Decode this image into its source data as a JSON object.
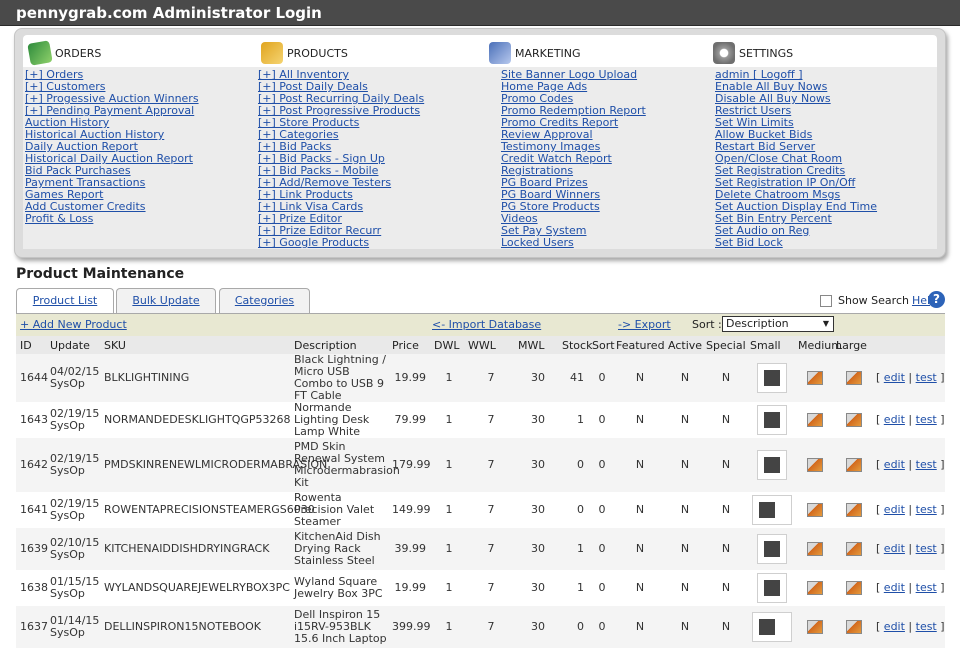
{
  "window": {
    "title": "pennygrab.com Administrator Login"
  },
  "menu": {
    "orders": {
      "heading": "ORDERS",
      "icon": "money-icon",
      "items": [
        "[+] Orders",
        "[+] Customers",
        "[+] Progessive Auction Winners",
        "[+] Pending Payment Approval",
        "Auction History",
        "Historical Auction History",
        "Daily Auction Report",
        "Historical Daily Auction Report",
        "Bid Pack Purchases",
        "Payment Transactions",
        "Games Report",
        "Add Customer Credits",
        "Profit & Loss"
      ]
    },
    "products": {
      "heading": "PRODUCTS",
      "icon": "box-icon",
      "items": [
        "[+] All Inventory",
        "[+] Post Daily Deals",
        "[+] Post Recurring Daily Deals",
        "[+] Post Progressive Products",
        "[+] Store Products",
        "[+] Categories",
        "[+] Bid Packs",
        "[+] Bid Packs - Sign Up",
        "[+] Bid Packs - Mobile",
        "[+] Add/Remove Testers",
        "[+] Link Products",
        "[+] Link Visa Cards",
        "[+] Prize Editor",
        "[+] Prize Editor Recurr",
        "[+] Google Products"
      ]
    },
    "marketing": {
      "heading": "MARKETING",
      "icon": "chart-icon",
      "items": [
        "Site Banner Logo Upload",
        "Home Page Ads",
        "Promo Codes",
        "Promo Redemption Report",
        "Promo Credits Report",
        "Review Approval",
        "Testimony Images",
        "Credit Watch Report",
        "Registrations",
        "PG Board Prizes",
        "PG Board Winners",
        "PG Store Products",
        "Videos",
        "Set Pay System",
        "Locked Users"
      ]
    },
    "settings": {
      "heading": "SETTINGS",
      "icon": "gear-icon",
      "items": [
        "admin [ Logoff ]",
        "Enable All Buy Nows",
        "Disable All Buy Nows",
        "Restrict Users",
        "Set Win Limits",
        "Allow Bucket Bids",
        "Restart Bid Server",
        "Open/Close Chat Room",
        "Set Registration Credits",
        "Set Registration IP On/Off",
        "Delete Chatroom Msgs",
        "Set Auction Display End Time",
        "Set Bin Entry Percent",
        "Set Audio on Reg",
        "Set Bid Lock"
      ]
    }
  },
  "main": {
    "title": "Product Maintenance",
    "tabs": [
      "Product List",
      "Bulk Update",
      "Categories"
    ],
    "show_search_label": "Show Search",
    "help_label": "Help",
    "add_new": "+ Add New Product",
    "import_db": "<- Import Database",
    "export": "-> Export",
    "sort_label": "Sort :",
    "sort_value": "Description"
  },
  "table": {
    "columns": [
      "ID",
      "Update",
      "SKU",
      "Description",
      "Price",
      "DWL",
      "WWL",
      "MWL",
      "Stock",
      "Sort",
      "Featured",
      "Active",
      "Special",
      "Small",
      "Medium",
      "Large",
      ""
    ],
    "rows": [
      {
        "id": "1644",
        "date": "04/02/15",
        "user": "SysOp",
        "sku": "BLKLIGHTINING",
        "desc": "Black Lightning / Micro USB Combo to USB 9 FT Cable",
        "price": "19.99",
        "dwl": "1",
        "wwl": "7",
        "mwl": "30",
        "stock": "41",
        "sort": "0",
        "featured": "N",
        "active": "N",
        "special": "N",
        "edit": "edit",
        "test": "test"
      },
      {
        "id": "1643",
        "date": "02/19/15",
        "user": "SysOp",
        "sku": "NORMANDEDESKLIGHTQGP53268",
        "desc": "Normande Lighting Desk Lamp White",
        "price": "79.99",
        "dwl": "1",
        "wwl": "7",
        "mwl": "30",
        "stock": "1",
        "sort": "0",
        "featured": "N",
        "active": "N",
        "special": "N",
        "edit": "edit",
        "test": "test"
      },
      {
        "id": "1642",
        "date": "02/19/15",
        "user": "SysOp",
        "sku": "PMDSKINRENEWLMICRODERMABRASION",
        "desc": "PMD Skin Renewal System Microdermabrasion Kit",
        "price": "179.99",
        "dwl": "1",
        "wwl": "7",
        "mwl": "30",
        "stock": "0",
        "sort": "0",
        "featured": "N",
        "active": "N",
        "special": "N",
        "edit": "edit",
        "test": "test"
      },
      {
        "id": "1641",
        "date": "02/19/15",
        "user": "SysOp",
        "sku": "ROWENTAPRECISIONSTEAMERGS6030",
        "desc": "Rowenta Precision Valet Steamer",
        "price": "149.99",
        "dwl": "1",
        "wwl": "7",
        "mwl": "30",
        "stock": "0",
        "sort": "0",
        "featured": "N",
        "active": "N",
        "special": "N",
        "edit": "edit",
        "test": "test"
      },
      {
        "id": "1639",
        "date": "02/10/15",
        "user": "SysOp",
        "sku": "KITCHENAIDDISHDRYINGRACK",
        "desc": "KitchenAid Dish Drying Rack Stainless Steel",
        "price": "39.99",
        "dwl": "1",
        "wwl": "7",
        "mwl": "30",
        "stock": "1",
        "sort": "0",
        "featured": "N",
        "active": "N",
        "special": "N",
        "edit": "edit",
        "test": "test"
      },
      {
        "id": "1638",
        "date": "01/15/15",
        "user": "SysOp",
        "sku": "WYLANDSQUAREJEWELRYBOX3PC",
        "desc": "Wyland Square Jewelry Box 3PC",
        "price": "19.99",
        "dwl": "1",
        "wwl": "7",
        "mwl": "30",
        "stock": "1",
        "sort": "0",
        "featured": "N",
        "active": "N",
        "special": "N",
        "edit": "edit",
        "test": "test"
      },
      {
        "id": "1637",
        "date": "01/14/15",
        "user": "SysOp",
        "sku": "DELLINSPIRON15NOTEBOOK",
        "desc": "Dell Inspiron 15 i15RV-953BLK 15.6 Inch Laptop",
        "price": "399.99",
        "dwl": "1",
        "wwl": "7",
        "mwl": "30",
        "stock": "0",
        "sort": "0",
        "featured": "N",
        "active": "N",
        "special": "N",
        "edit": "edit",
        "test": "test"
      }
    ]
  },
  "colors": {
    "titlebar": "#4a4a4a",
    "link": "#1f4fa8",
    "toolbar": "#e8e8d2",
    "menu_bg": "#dcdcdc"
  }
}
